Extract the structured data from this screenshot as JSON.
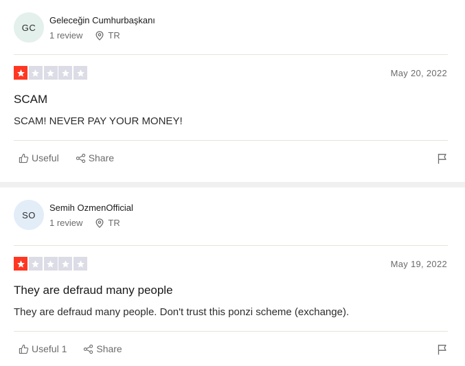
{
  "reviews": [
    {
      "initials": "GC",
      "name": "Geleceğin Cumhurbaşkanı",
      "review_count": "1 review",
      "country": "TR",
      "rating": 1,
      "date": "May 20, 2022",
      "title": "SCAM",
      "body": "SCAM! NEVER PAY YOUR MONEY!",
      "useful_label": "Useful",
      "share_label": "Share"
    },
    {
      "initials": "SO",
      "name": "Semih OzmenOfficial",
      "review_count": "1 review",
      "country": "TR",
      "rating": 1,
      "date": "May 19, 2022",
      "title": "They are defraud many people",
      "body": "They are defraud many people. Don't trust this ponzi scheme (exchange).",
      "useful_label": "Useful 1",
      "share_label": "Share"
    }
  ],
  "colors": {
    "star_on": "#ff3722",
    "star_off": "#dcdce6"
  },
  "icons": [
    "location-pin-icon",
    "star-icon",
    "thumbs-up-icon",
    "share-icon",
    "flag-icon"
  ]
}
